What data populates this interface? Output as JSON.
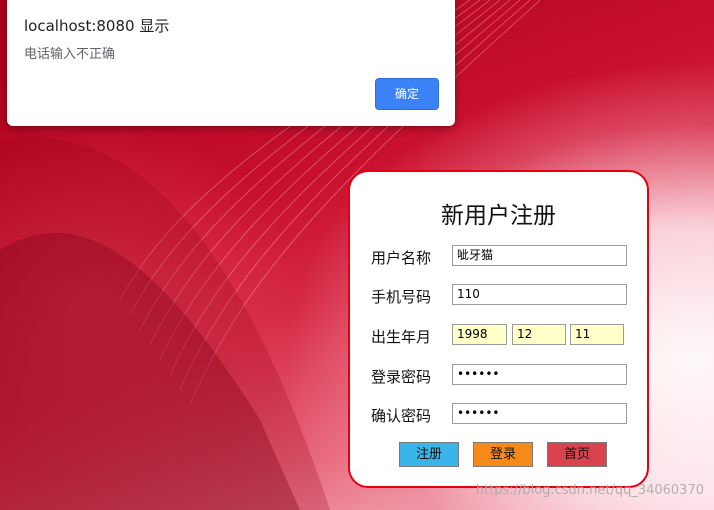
{
  "alert": {
    "title": "localhost:8080 显示",
    "message": "电话输入不正确",
    "ok_label": "确定"
  },
  "form": {
    "title": "新用户注册",
    "username_label": "用户名称",
    "username_value": "呲牙猫",
    "phone_label": "手机号码",
    "phone_value": "110",
    "birth_label": "出生年月",
    "birth_year": "1998",
    "birth_month": "12",
    "birth_day": "11",
    "password_label": "登录密码",
    "password_value": "••••••",
    "confirm_label": "确认密码",
    "confirm_value": "••••••",
    "register_label": "注册",
    "login_label": "登录",
    "home_label": "首页"
  },
  "watermark": "https://blog.csdn.net/qq_34060370",
  "colors": {
    "card_border": "#e3000f",
    "alert_button": "#3b82f6",
    "register_button": "#3bb4ea",
    "login_button": "#f58a1a",
    "home_button": "#d9434d",
    "date_field_bg": "#ffffc8"
  }
}
